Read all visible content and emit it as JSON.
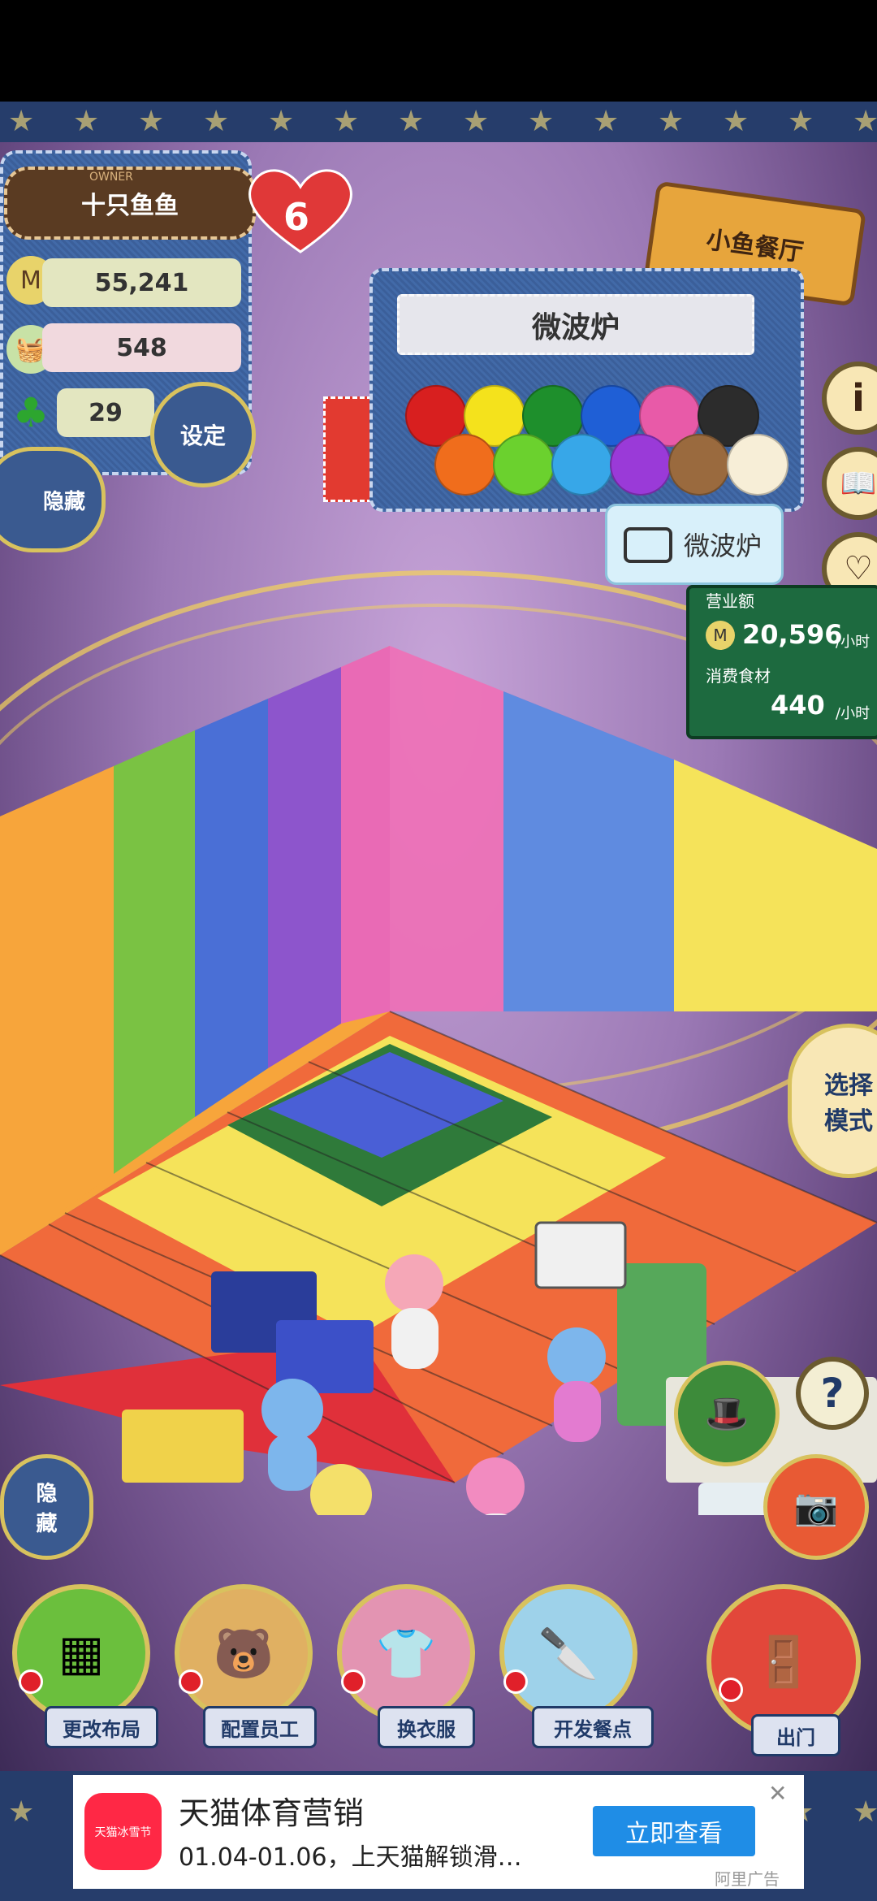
{
  "owner": {
    "caption": "OWNER",
    "name": "十只鱼鱼"
  },
  "level": "6",
  "stats": {
    "money": "55,241",
    "food": "548",
    "clover": "29"
  },
  "settings_label": "设定",
  "hide_left_label": "隐藏",
  "hide_vertical_label": "隐\n藏",
  "restaurant_sign": "小鱼餐厅",
  "popup": {
    "title": "微波炉",
    "colors": [
      "#d81f1f",
      "#f4e21c",
      "#1e8f2c",
      "#1f5fd6",
      "#e85aa8",
      "#2c2c2c",
      "#f06d1c",
      "#6bd12e",
      "#37a7e8",
      "#9a3ad8",
      "#9a6a3e",
      "#f7eed7"
    ]
  },
  "tooltip_label": "微波炉",
  "stats_board": {
    "label1": "营业额",
    "money_rate": "20,596",
    "unit1": "/小时",
    "label2": "消费食材",
    "food_rate": "440",
    "unit2": "/小时"
  },
  "mode_button": "选择\n模式",
  "menu": [
    {
      "label": "更改布局",
      "icon": "table-icon",
      "color": "#6bbf3d"
    },
    {
      "label": "配置员工",
      "icon": "bear-icon",
      "color": "#e0b062"
    },
    {
      "label": "换衣服",
      "icon": "shirt-icon",
      "color": "#e394b2"
    },
    {
      "label": "开发餐点",
      "icon": "knife-icon",
      "color": "#9ed2ea"
    },
    {
      "label": "出门",
      "icon": "door-icon",
      "color": "#e2473a"
    }
  ],
  "ad": {
    "title": "天猫体育营销",
    "subtitle": "01.04-01.06，上天猫解锁滑…",
    "button": "立即查看",
    "logo": "天猫冰雪节",
    "tag": "阿里广告",
    "close": "✕"
  }
}
